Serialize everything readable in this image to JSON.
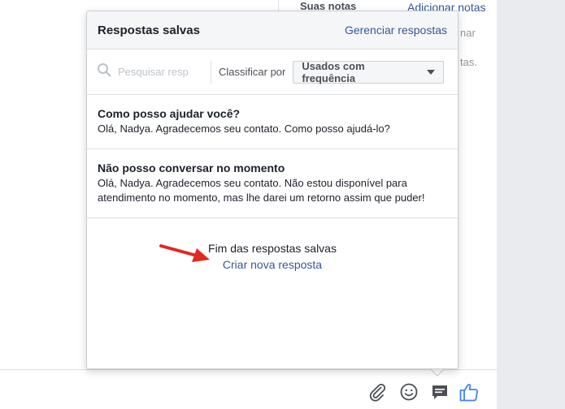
{
  "background": {
    "notes_title": "Suas notas",
    "add_notes": "Adicionar notas",
    "side_text_1": "nar",
    "side_text_2": "tas."
  },
  "popup": {
    "title": "Respostas salvas",
    "manage_link": "Gerenciar respostas",
    "search_placeholder": "Pesquisar resp",
    "sort_label": "Classificar por",
    "sort_value": "Usados com frequência",
    "replies": [
      {
        "title": "Como posso ajudar você?",
        "body": "Olá, Nadya. Agradecemos seu contato. Como posso ajudá-lo?"
      },
      {
        "title": "Não posso conversar no momento",
        "body": "Olá, Nadya. Agradecemos seu contato. Não estou disponível para atendimento no momento, mas lhe darei um retorno assim que puder!"
      }
    ],
    "end_text": "Fim das respostas salvas",
    "create_link": "Criar nova resposta"
  },
  "icons": {
    "search": "search-icon",
    "attach": "paperclip-icon",
    "emoji": "smiley-icon",
    "saved_replies": "chat-bubble-icon",
    "like": "thumbs-up-icon",
    "annotation": "red-arrow-icon"
  },
  "colors": {
    "link": "#365899",
    "like_blue": "#4080ff",
    "arrow_red": "#e02a20",
    "icon_gray": "#4b4f56"
  }
}
